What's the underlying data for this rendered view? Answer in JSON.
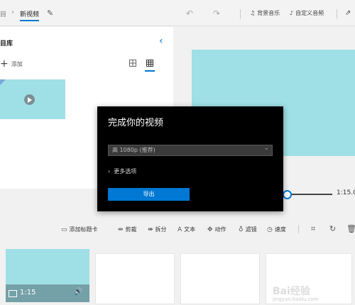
{
  "topbar": {
    "breadcrumb_parent": "目",
    "breadcrumb_current": "新视频",
    "music_label": "背景音乐",
    "custom_audio_label": "自定义音频"
  },
  "library": {
    "title": "目库",
    "add_label": "添加"
  },
  "playback": {
    "time": "1:15.0"
  },
  "storyboard_tools": {
    "add_title_card": "添加标题卡",
    "trim": "剪裁",
    "split": "拆分",
    "text": "文本",
    "motion": "动作",
    "filters": "滤镜",
    "speed": "速度"
  },
  "storyboard": {
    "clip_duration": "1:15"
  },
  "dialog": {
    "title": "完成你的视频",
    "quality_selected": "高 1080p (推荐)",
    "more_options": "更多选项",
    "export_label": "导出"
  },
  "watermark": {
    "brand": "Bai经验",
    "url": "jingyan.baidu.com"
  },
  "colors": {
    "accent": "#0078d4",
    "media": "#9fe0e6",
    "dialog_bg": "#000000"
  }
}
